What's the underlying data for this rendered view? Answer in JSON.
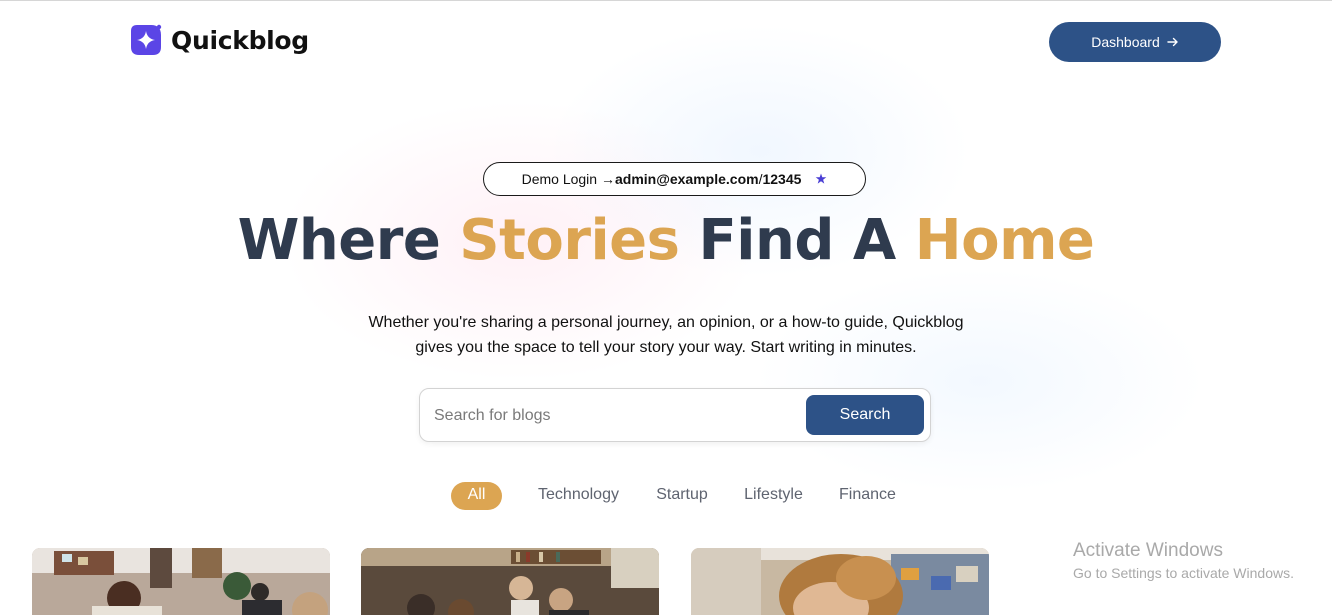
{
  "header": {
    "brand": "Quickblog",
    "dashboard_label": "Dashboard"
  },
  "hero": {
    "demo_prefix": "Demo Login → ",
    "demo_email": "admin@example.com",
    "demo_separator": " / ",
    "demo_password": "12345",
    "headline": {
      "word1": "Where ",
      "word2": "Stories",
      "word3": " Find A ",
      "word4": "Home"
    },
    "subtext_line1": "Whether you're sharing a personal journey, an opinion, or a how-to guide, Quickblog",
    "subtext_line2": "gives you the space to tell your story your way. Start writing in minutes."
  },
  "search": {
    "placeholder": "Search for blogs",
    "button_label": "Search"
  },
  "categories": [
    {
      "label": "All",
      "active": true
    },
    {
      "label": "Technology",
      "active": false
    },
    {
      "label": "Startup",
      "active": false
    },
    {
      "label": "Lifestyle",
      "active": false
    },
    {
      "label": "Finance",
      "active": false
    }
  ],
  "cards": [
    {
      "image": "people-at-office-photo"
    },
    {
      "image": "team-meeting-photo"
    },
    {
      "image": "woman-portrait-photo"
    }
  ],
  "watermark": {
    "title": "Activate Windows",
    "subtitle": "Go to Settings to activate Windows."
  },
  "colors": {
    "primary": "#2d5287",
    "accent": "#dca552",
    "logo": "#5b45e6",
    "headline_dark": "#2f3b4e"
  }
}
